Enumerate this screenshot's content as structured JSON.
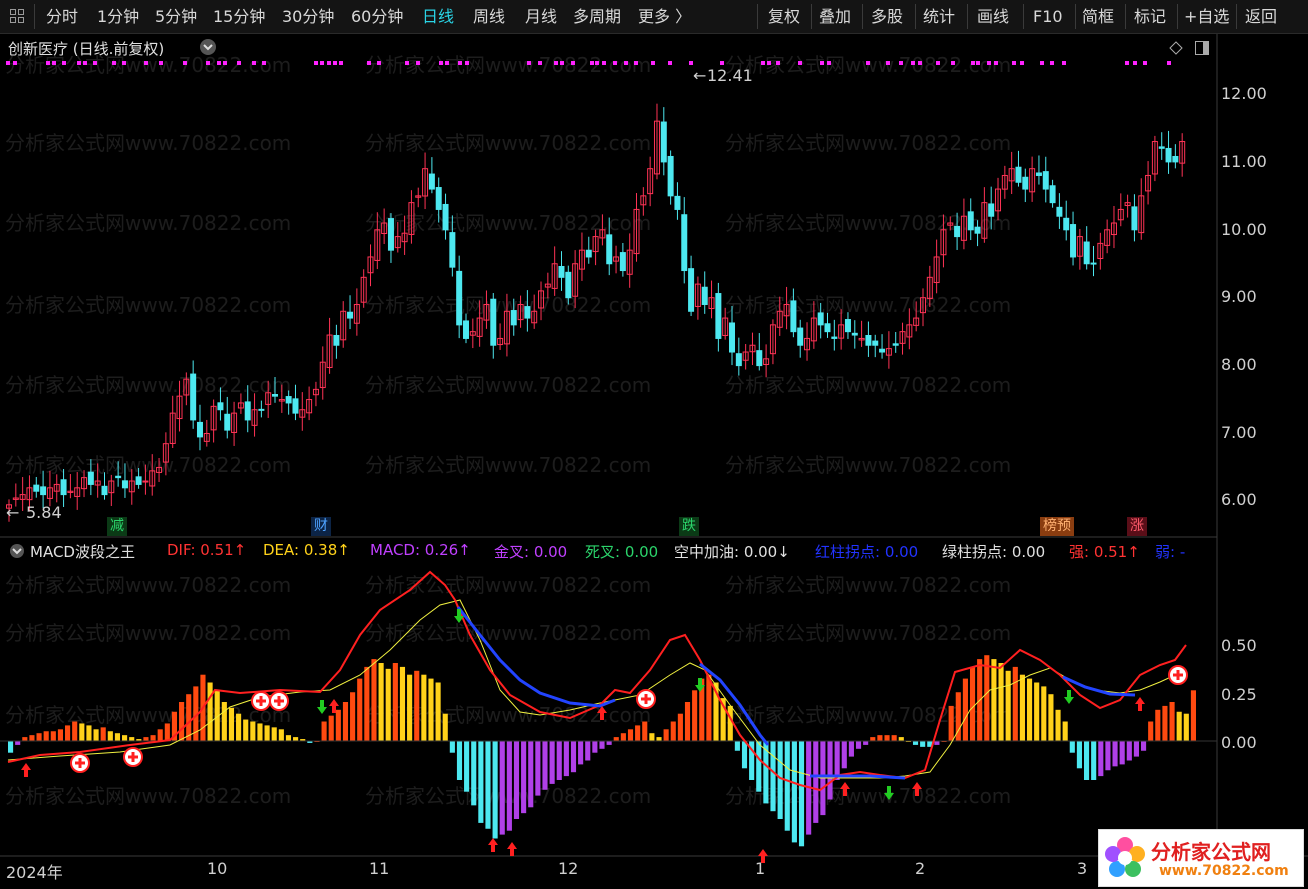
{
  "toolbar": {
    "periods": [
      "分时",
      "1分钟",
      "5分钟",
      "15分钟",
      "30分钟",
      "60分钟",
      "日线",
      "周线",
      "月线",
      "多周期",
      "更多 〉"
    ],
    "active_period": "日线",
    "tools": [
      "复权",
      "叠加",
      "多股",
      "统计",
      "画线",
      "F10",
      "简框",
      "标记",
      "+自选",
      "返回"
    ]
  },
  "main_pane": {
    "title": "创新医疗 (日线.前复权)",
    "high_label": "12.41",
    "low_label": "5.84",
    "y_ticks": [
      "12.00",
      "11.00",
      "10.00",
      "9.00",
      "8.00",
      "7.00",
      "6.00"
    ],
    "markers": [
      {
        "text": "减",
        "color": "#2bd46b",
        "bg": "#0b3a16"
      },
      {
        "text": "财",
        "color": "#4ea2ff",
        "bg": "#0c2446"
      },
      {
        "text": "跌",
        "color": "#2bd46b",
        "bg": "#0b3a16"
      },
      {
        "text": "榜预",
        "color": "#ffb070",
        "bg": "#8a3d10"
      },
      {
        "text": "涨",
        "color": "#ff5b6b",
        "bg": "#5a0e18"
      }
    ]
  },
  "indicator_pane": {
    "name": "MACD波段之王",
    "items": [
      {
        "label": "DIF: 0.51↑",
        "color": "#ff3333"
      },
      {
        "label": "DEA: 0.38↑",
        "color": "#ffd21a"
      },
      {
        "label": "MACD: 0.26↑",
        "color": "#c040ff"
      },
      {
        "label": "金叉: 0.00",
        "color": "#c040ff"
      },
      {
        "label": "死叉: 0.00",
        "color": "#2bd46b"
      },
      {
        "label": "空中加油: 0.00↓",
        "color": "#e0e0e0"
      },
      {
        "label": "红柱拐点: 0.00",
        "color": "#2233ff"
      },
      {
        "label": "绿柱拐点: 0.00",
        "color": "#e0e0e0"
      },
      {
        "label": "强: 0.51↑",
        "color": "#ff3333"
      },
      {
        "label": "弱: -",
        "color": "#2233ff"
      }
    ],
    "y_ticks": [
      "0.50",
      "0.25",
      "0.00"
    ]
  },
  "x_axis": [
    "2024年",
    "10",
    "11",
    "12",
    "1",
    "2",
    "3"
  ],
  "watermark": "分析家公式网www.70822.com",
  "logo": {
    "title": "分析家公式网",
    "url": "www.70822.com"
  },
  "colors": {
    "up": "#ff3355",
    "down": "#4de8f0",
    "dif": "#ff2020",
    "dea": "#f0f040",
    "macd_red": "#ff4a10",
    "macd_yellow": "#ffd21a",
    "macd_cyan": "#4de8f0",
    "macd_purple": "#b040e8",
    "blue_line": "#2244ff",
    "dots": "#ff22ff"
  }
}
